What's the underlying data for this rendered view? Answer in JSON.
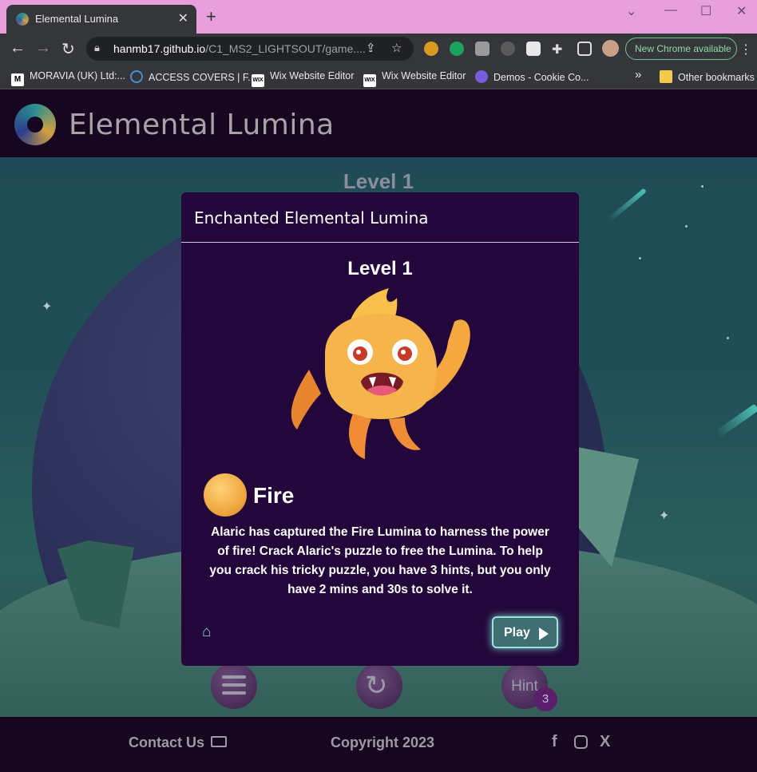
{
  "browser": {
    "tab_title": "Elemental Lumina",
    "tab_close": "✕",
    "new_tab": "+",
    "url_host": "hanmb17.github.io",
    "url_path": "/C1_MS2_LIGHTSOUT/game....",
    "new_chrome_label": "New Chrome available",
    "bookmarks": [
      {
        "label": "MORAVIA (UK) Ltd:...",
        "icon": "M"
      },
      {
        "label": "ACCESS COVERS | F...",
        "icon": "ring"
      },
      {
        "label": "Wix Website Editor",
        "icon": "WIX"
      },
      {
        "label": "Wix Website Editor",
        "icon": "WIX"
      },
      {
        "label": "Demos - Cookie Co...",
        "icon": "circle"
      }
    ],
    "more_bookmarks": "»",
    "other_bookmarks": "Other bookmarks"
  },
  "site": {
    "title": "Elemental Lumina",
    "level_label": "Level 1",
    "hint_label": "Hint",
    "hint_count": "3"
  },
  "modal": {
    "title": "Enchanted Elemental Lumina",
    "level": "Level 1",
    "element_name": "Fire",
    "description": "Alaric has captured the Fire Lumina to harness the power of fire! Crack Alaric's puzzle to free the Lumina. To help you crack his tricky puzzle, you have 3 hints, but you only have 2 mins and 30s to solve it.",
    "play_label": "Play"
  },
  "footer": {
    "contact": "Contact Us",
    "copyright": "Copyright 2023"
  },
  "colors": {
    "header_bg": "#17061f",
    "modal_bg": "#23073a",
    "accent_teal": "#9ee0d8"
  }
}
